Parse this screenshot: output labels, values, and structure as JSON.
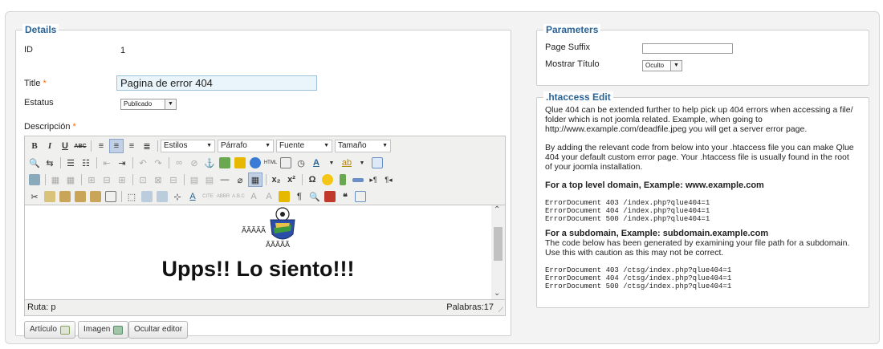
{
  "details": {
    "legend": "Details",
    "id_label": "ID",
    "id_value": "1",
    "title_label": "Title",
    "title_value": "Pagina de error 404",
    "status_label": "Estatus",
    "status_value": "Publicado",
    "description_label": "Descripción",
    "required_mark": "*"
  },
  "editor": {
    "toolbar": {
      "bold": "B",
      "italic": "I",
      "underline": "U",
      "strike": "ABC",
      "styles": "Estilos",
      "paragraph": "Párrafo",
      "font": "Fuente",
      "size": "Tamaño",
      "subscript": "x₂",
      "superscript": "x²",
      "omega": "Ω",
      "pilcrow": "¶",
      "quote": "❝"
    },
    "body": {
      "garbled1": "ÃÃÃÃÃ",
      "garbled2": "ÃÃÃÃÃ",
      "heading": "Upps!! Lo siento!!!"
    },
    "path_label": "Ruta: p",
    "words_label": "Palabras:17"
  },
  "buttons": {
    "article": "Artículo",
    "image": "Imagen",
    "toggle_editor": "Ocultar editor"
  },
  "parameters": {
    "legend": "Parameters",
    "suffix_label": "Page Suffix",
    "suffix_value": "",
    "show_title_label": "Mostrar Título",
    "show_title_value": "Oculto"
  },
  "htaccess": {
    "legend": ".htaccess Edit",
    "intro": "Qlue 404 can be extended further to help pick up 404 errors when accessing a file/ folder which is not joomla related. Example, when going to http://www.example.com/deadfile.jpeg you will get a server error page.",
    "para2": "By adding the relevant code from below into your .htaccess file you can make Qlue 404 your default custom error page. Your .htaccess file is usually found in the root of your joomla installation.",
    "top_heading": "For a top level domain, Example: www.example.com",
    "top_code": "ErrorDocument 403 /index.php?qlue404=1\nErrorDocument 404 /index.php?qlue404=1\nErrorDocument 500 /index.php?qlue404=1",
    "sub_heading": "For a subdomain, Example: subdomain.example.com",
    "sub_text": "The code below has been generated by examining your file path for a subdomain. Use this with caution as this may not be correct.",
    "sub_code": "ErrorDocument 403 /ctsg/index.php?qlue404=1\nErrorDocument 404 /ctsg/index.php?qlue404=1\nErrorDocument 500 /ctsg/index.php?qlue404=1"
  },
  "colors": {
    "legend": "#2a6496",
    "required": "#ff6600",
    "title_bg": "#eaf4fb"
  }
}
